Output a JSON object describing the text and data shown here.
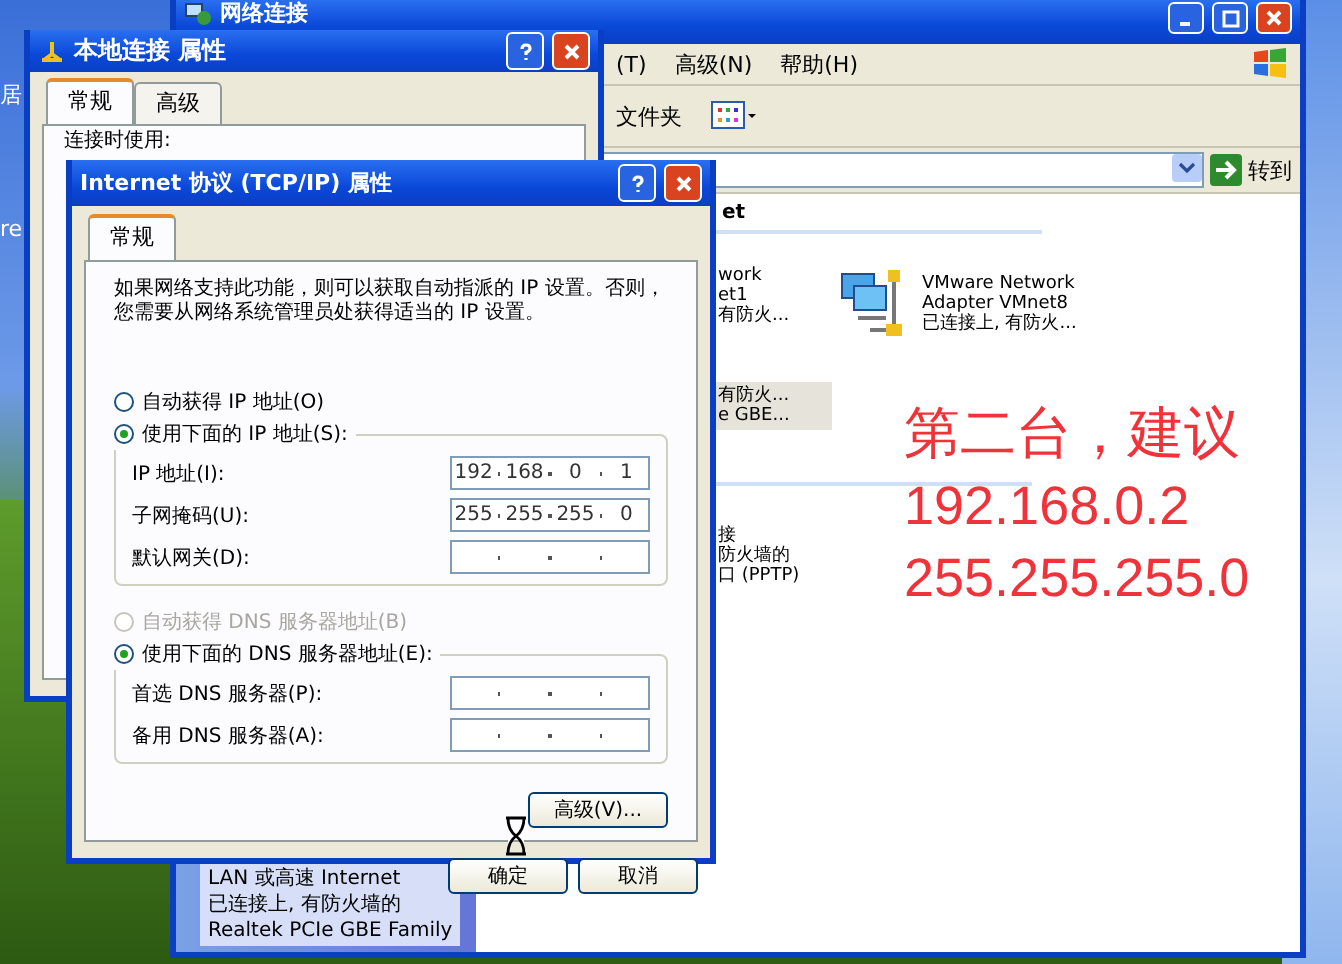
{
  "desktop": {
    "icon_labels": [
      "居",
      "re"
    ]
  },
  "explorer": {
    "title": "网络连接",
    "menu": [
      "(T)",
      "高级(N)",
      "帮助(H)"
    ],
    "folders_button": "文件夹",
    "go_button": "转到",
    "group_header": "et",
    "items": [
      {
        "lines": [
          "work",
          "et1",
          "有防火..."
        ],
        "selected": false
      },
      {
        "lines": [
          "VMware Network",
          "Adapter VMnet8",
          "已连接上, 有防火..."
        ],
        "selected": false
      },
      {
        "lines": [
          "有防火...",
          "e GBE..."
        ],
        "selected": true
      },
      {
        "lines": [
          "接",
          "防火墙的",
          "口 (PPTP)"
        ],
        "selected": false
      }
    ],
    "details": [
      "LAN 或高速 Internet",
      "已连接上, 有防火墙的",
      "Realtek PCIe GBE Family"
    ]
  },
  "connection_dialog": {
    "title": "本地连接  属性",
    "tabs": [
      {
        "label": "常规",
        "selected": true
      },
      {
        "label": "高级",
        "selected": false
      }
    ],
    "connect_using": "连接时使用:"
  },
  "tcpip_dialog": {
    "title": "Internet 协议 (TCP/IP) 属性",
    "tabs": [
      {
        "label": "常规",
        "selected": true
      }
    ],
    "description": "如果网络支持此功能，则可以获取自动指派的 IP 设置。否则，您需要从网络系统管理员处获得适当的 IP 设置。",
    "ip_options": [
      {
        "label": "自动获得 IP 地址(O)",
        "selected": false,
        "disabled": false
      },
      {
        "label": "使用下面的 IP 地址(S):",
        "selected": true,
        "disabled": false
      }
    ],
    "ip_fields": [
      {
        "label": "IP 地址(I):",
        "octets": [
          "192",
          "168",
          "0",
          "1"
        ]
      },
      {
        "label": "子网掩码(U):",
        "octets": [
          "255",
          "255",
          "255",
          "0"
        ]
      },
      {
        "label": "默认网关(D):"
      }
    ],
    "dns_options": [
      {
        "label": "自动获得 DNS 服务器地址(B)",
        "selected": false,
        "disabled": true
      },
      {
        "label": "使用下面的 DNS 服务器地址(E):",
        "selected": true,
        "disabled": false
      }
    ],
    "dns_fields": [
      {
        "label": "首选 DNS 服务器(P):"
      },
      {
        "label": "备用 DNS 服务器(A):"
      }
    ],
    "advanced_button": "高级(V)...",
    "buttons": [
      "确定",
      "取消"
    ]
  },
  "annotation": [
    "第二台，建议",
    "192.168.0.2",
    "255.255.255.0"
  ]
}
